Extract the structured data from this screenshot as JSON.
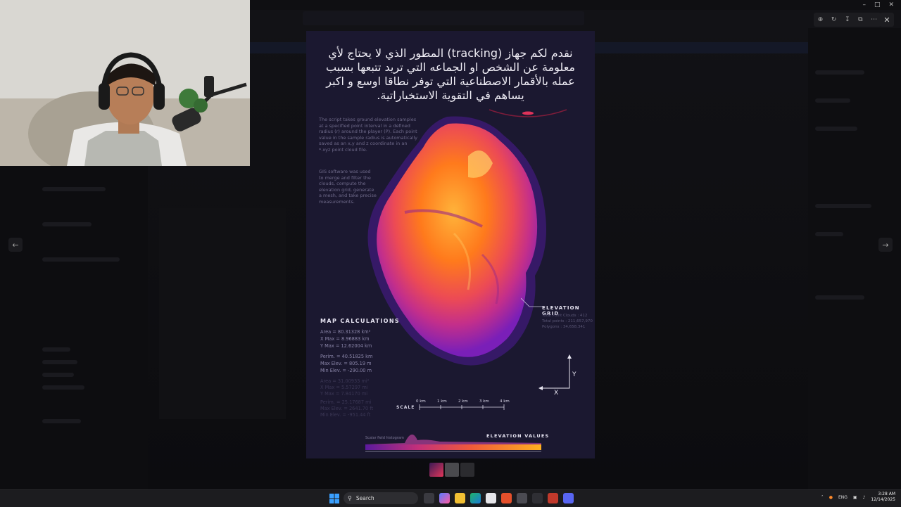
{
  "poster": {
    "title_lines": [
      "نقدم لكم جهاز (tracking) المطور الذي لا يحتاج لأي",
      "معلومة عن الشخص او الجماعه التي تريد تتبعها بسبب",
      "عمله بالأقمار الاصطناعية التي توفر نطاقا اوسع و اكبر",
      "يساهم في التقوية الاستخباراتية."
    ],
    "description_1": "The script takes ground elevation samples at a specified point interval in a defined radius (r) around the player (P). Each point value in the sample radius is automatically saved as an x,y and z coordinate in an *.xyz point cloud file.",
    "description_2": "GIS software was used to merge and filter the clouds, compute the elevation grid, generate a mesh, and take precise measurements.",
    "map_calculations": {
      "title": "MAP CALCULATIONS",
      "area": "Area = 80.31328 km²",
      "xmax": "X Max = 8.96883 km",
      "ymax": "Y Max = 12.62004 km",
      "perim": "Perim. = 40.51825 km",
      "max_elev": "Max Elev. = 805.19 m",
      "min_elev": "Min Elev. = -290.00 m",
      "dim_area": "Area = 31.00933 mi²",
      "dim_xmax": "X Max = 5.57297 mi",
      "dim_ymax": "Y Max = 7.84170 mi",
      "dim_perim": "Perim. = 25.17687 mi",
      "dim_max_elev": "Max Elev. = 2641.70 ft",
      "dim_min_elev": "Min Elev. = -951.44 ft"
    },
    "elevation_grid": {
      "title": "ELEVATION GRID",
      "line1": "Total Point Clouds : 412",
      "line2": "Total points : 211,657,970",
      "line3": "Polygons : 34,658,341"
    },
    "axes": {
      "y": "Y",
      "x": "X"
    },
    "scale": {
      "label": "SCALE",
      "ticks": [
        "0 km",
        "1 km",
        "2 km",
        "3 km",
        "4 km"
      ]
    },
    "elevation_values": {
      "title": "ELEVATION VALUES",
      "histogram_label": "Scalar field histogram"
    }
  },
  "taskbar": {
    "search_placeholder": "Search",
    "language": "ENG",
    "time": "3:28 AM",
    "date": "12/14/2025"
  },
  "colors": {
    "poster_bg": "#1b1830",
    "terrain_hot": "#ff8a1a",
    "terrain_mid": "#e23c6a",
    "terrain_edge": "#7a1fb8",
    "taskbar": "#1c1c1f"
  },
  "icons": {
    "viewer": [
      "zoom-in-icon",
      "rotate-icon",
      "download-icon",
      "open-external-icon",
      "more-icon",
      "close-icon"
    ],
    "nav": [
      "arrow-left-icon",
      "arrow-right-icon"
    ]
  }
}
